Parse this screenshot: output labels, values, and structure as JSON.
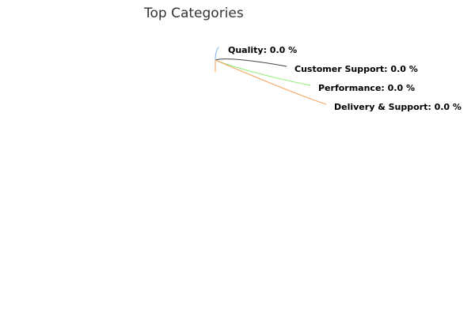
{
  "chart_data": {
    "type": "pie",
    "title": "Top Categories",
    "slices": [
      {
        "name": "Quality",
        "value": 0.0,
        "label": "Quality: 0.0 %",
        "color": "#7cb5ec"
      },
      {
        "name": "Customer Support",
        "value": 0.0,
        "label": "Customer Support: 0.0 %",
        "color": "#434348"
      },
      {
        "name": "Performance",
        "value": 0.0,
        "label": "Performance: 0.0 %",
        "color": "#90ed7d"
      },
      {
        "name": "Delivery & Support",
        "value": 0.0,
        "label": "Delivery & Support: 0.0 %",
        "color": "#f7a35c"
      }
    ]
  }
}
